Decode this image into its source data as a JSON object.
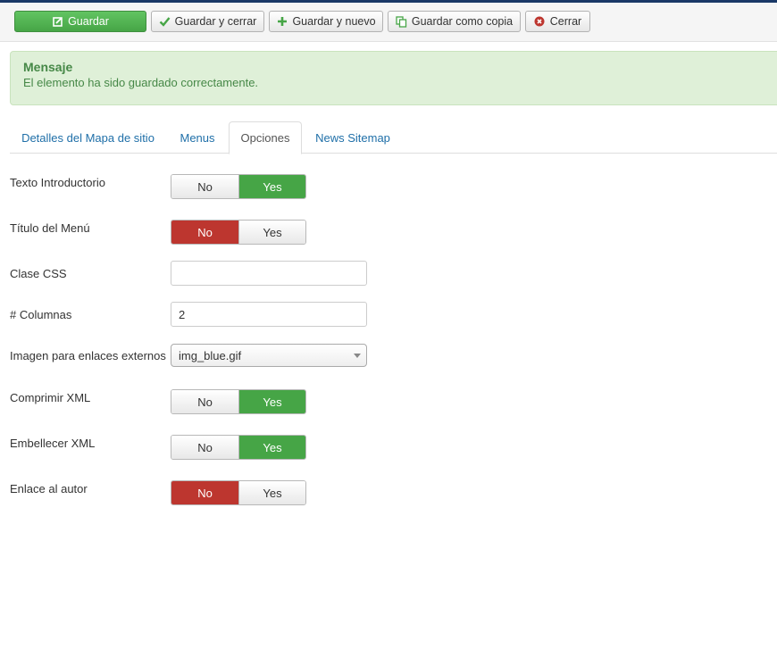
{
  "toolbar": {
    "save_label": "Guardar",
    "save_close_label": "Guardar y cerrar",
    "save_new_label": "Guardar y nuevo",
    "save_copy_label": "Guardar como copia",
    "close_label": "Cerrar"
  },
  "message": {
    "heading": "Mensaje",
    "text": "El elemento ha sido guardado correctamente."
  },
  "tabs": [
    {
      "label": "Detalles del Mapa de sitio",
      "active": false
    },
    {
      "label": "Menus",
      "active": false
    },
    {
      "label": "Opciones",
      "active": true
    },
    {
      "label": "News Sitemap",
      "active": false
    }
  ],
  "form": {
    "intro_text": {
      "label": "Texto Introductorio",
      "no": "No",
      "yes": "Yes",
      "value": "Yes"
    },
    "menu_title": {
      "label": "Título del Menú",
      "no": "No",
      "yes": "Yes",
      "value": "No"
    },
    "css_class": {
      "label": "Clase CSS",
      "value": ""
    },
    "columns": {
      "label": "# Columnas",
      "value": "2"
    },
    "external_image": {
      "label": "Imagen para enlaces externos",
      "value": "img_blue.gif"
    },
    "compress_xml": {
      "label": "Comprimir XML",
      "no": "No",
      "yes": "Yes",
      "value": "Yes"
    },
    "beautify_xml": {
      "label": "Embellecer XML",
      "no": "No",
      "yes": "Yes",
      "value": "Yes"
    },
    "author_link": {
      "label": "Enlace al autor",
      "no": "No",
      "yes": "Yes",
      "value": "No"
    }
  },
  "colors": {
    "success": "#46a546",
    "danger": "#bd362f",
    "alert_bg": "#dff0d8",
    "link": "#1f6fa8"
  }
}
